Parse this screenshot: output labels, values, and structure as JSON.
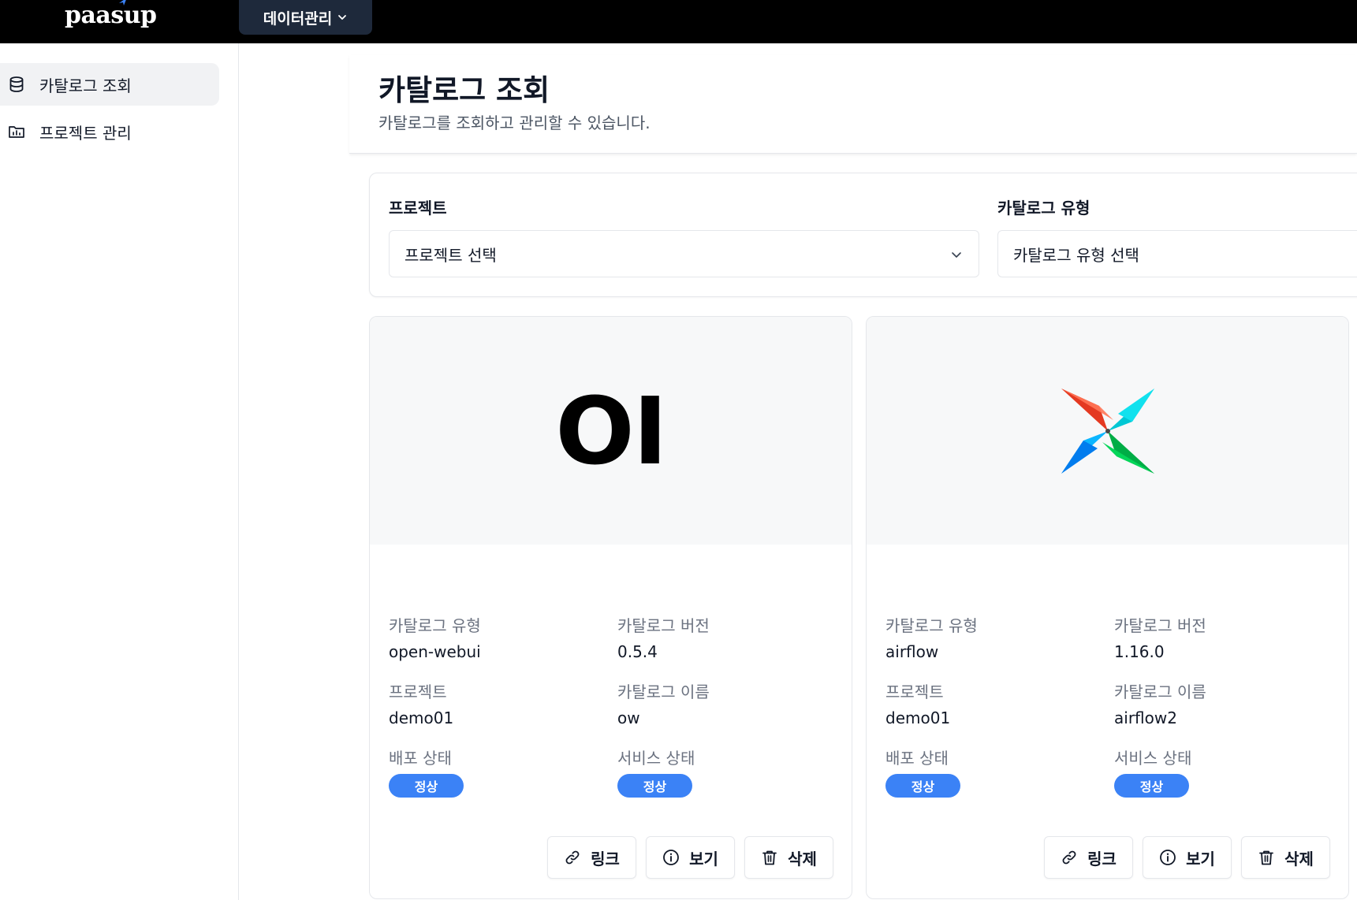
{
  "topbar": {
    "logo": "paasup",
    "menu_label": "데이터관리"
  },
  "sidebar": {
    "items": [
      {
        "label": "카탈로그 조회",
        "icon": "database-icon",
        "active": true
      },
      {
        "label": "프로젝트 관리",
        "icon": "folder-chart-icon",
        "active": false
      }
    ]
  },
  "header": {
    "title": "카탈로그 조회",
    "subtitle": "카탈로그를 조회하고 관리할 수 있습니다."
  },
  "filters": {
    "project": {
      "label": "프로젝트",
      "value": "프로젝트 선택"
    },
    "catalog_type": {
      "label": "카탈로그 유형",
      "value": "카탈로그 유형 선택"
    }
  },
  "field_labels": {
    "type": "카탈로그 유형",
    "version": "카탈로그 버전",
    "project": "프로젝트",
    "name": "카탈로그 이름",
    "deploy_status": "배포 상태",
    "service_status": "서비스 상태"
  },
  "buttons": {
    "link": "링크",
    "view": "보기",
    "delete": "삭제"
  },
  "cards": [
    {
      "logo_text": "OI",
      "type": "open-webui",
      "version": "0.5.4",
      "project": "demo01",
      "name": "ow",
      "deploy_status": "정상",
      "service_status": "정상"
    },
    {
      "logo": "airflow-logo",
      "type": "airflow",
      "version": "1.16.0",
      "project": "demo01",
      "name": "airflow2",
      "deploy_status": "정상",
      "service_status": "정상"
    }
  ],
  "colors": {
    "badge": "#3b82f6",
    "topbar": "#000000",
    "nav_menu": "#1e293b"
  }
}
